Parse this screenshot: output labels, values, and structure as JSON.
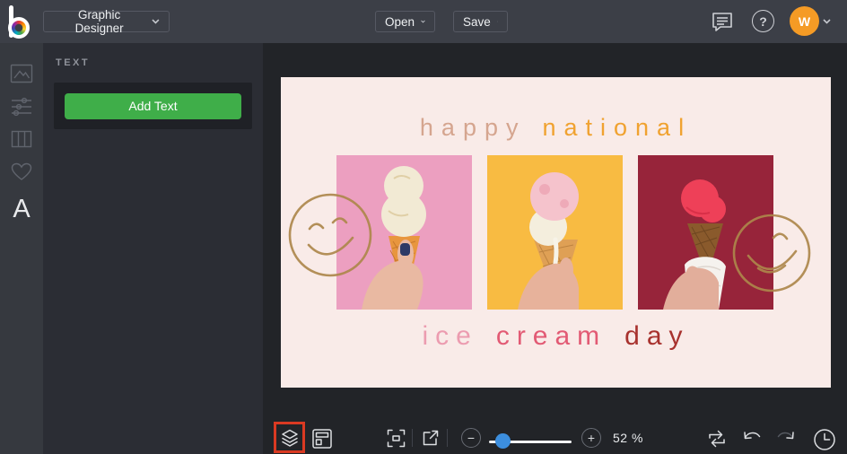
{
  "topbar": {
    "menu_label": "Graphic Designer",
    "open_label": "Open",
    "save_label": "Save",
    "help_glyph": "?",
    "avatar_initial": "W"
  },
  "sidebar": {
    "items": [
      {
        "id": "photos",
        "icon": "image-icon"
      },
      {
        "id": "edit",
        "icon": "adjustments-icon"
      },
      {
        "id": "layouts",
        "icon": "columns-icon"
      },
      {
        "id": "favorites",
        "icon": "heart-icon"
      },
      {
        "id": "text",
        "icon": "text-icon",
        "glyph": "A",
        "active": true
      }
    ]
  },
  "panel": {
    "title": "TEXT",
    "add_text_label": "Add Text",
    "button_color": "#3fae49"
  },
  "canvas": {
    "background": "#f9ebe8",
    "title": {
      "word1": "happy",
      "word2": "national",
      "word1_color": "#d5a58f",
      "word2_color": "#f0a230"
    },
    "footer": {
      "word1": "ice",
      "word2": "cream",
      "word3": "day",
      "word1_color": "#ec9cb0",
      "word2_color": "#e25a74",
      "word3_color": "#a8322e"
    },
    "photos": [
      {
        "name": "vanilla-cone-on-pink",
        "bg": "#ec9fc0"
      },
      {
        "name": "strawberry-cone-on-amber",
        "bg": "#f8bb42"
      },
      {
        "name": "red-sorbet-cone-on-darkred",
        "bg": "#97243a"
      }
    ],
    "smiley_color": "#ad874b"
  },
  "toolbar": {
    "zoom_value": "52 %",
    "minus_glyph": "−",
    "plus_glyph": "+",
    "highlight_color": "#da3a22",
    "slider_color": "#3c8ede",
    "icons": [
      "layers-icon",
      "resize-template-icon",
      "fit-screen-icon",
      "open-new-window-icon",
      "zoom-out-icon",
      "zoom-slider",
      "zoom-in-icon",
      "compare-icon",
      "undo-icon",
      "redo-icon",
      "history-icon"
    ]
  }
}
